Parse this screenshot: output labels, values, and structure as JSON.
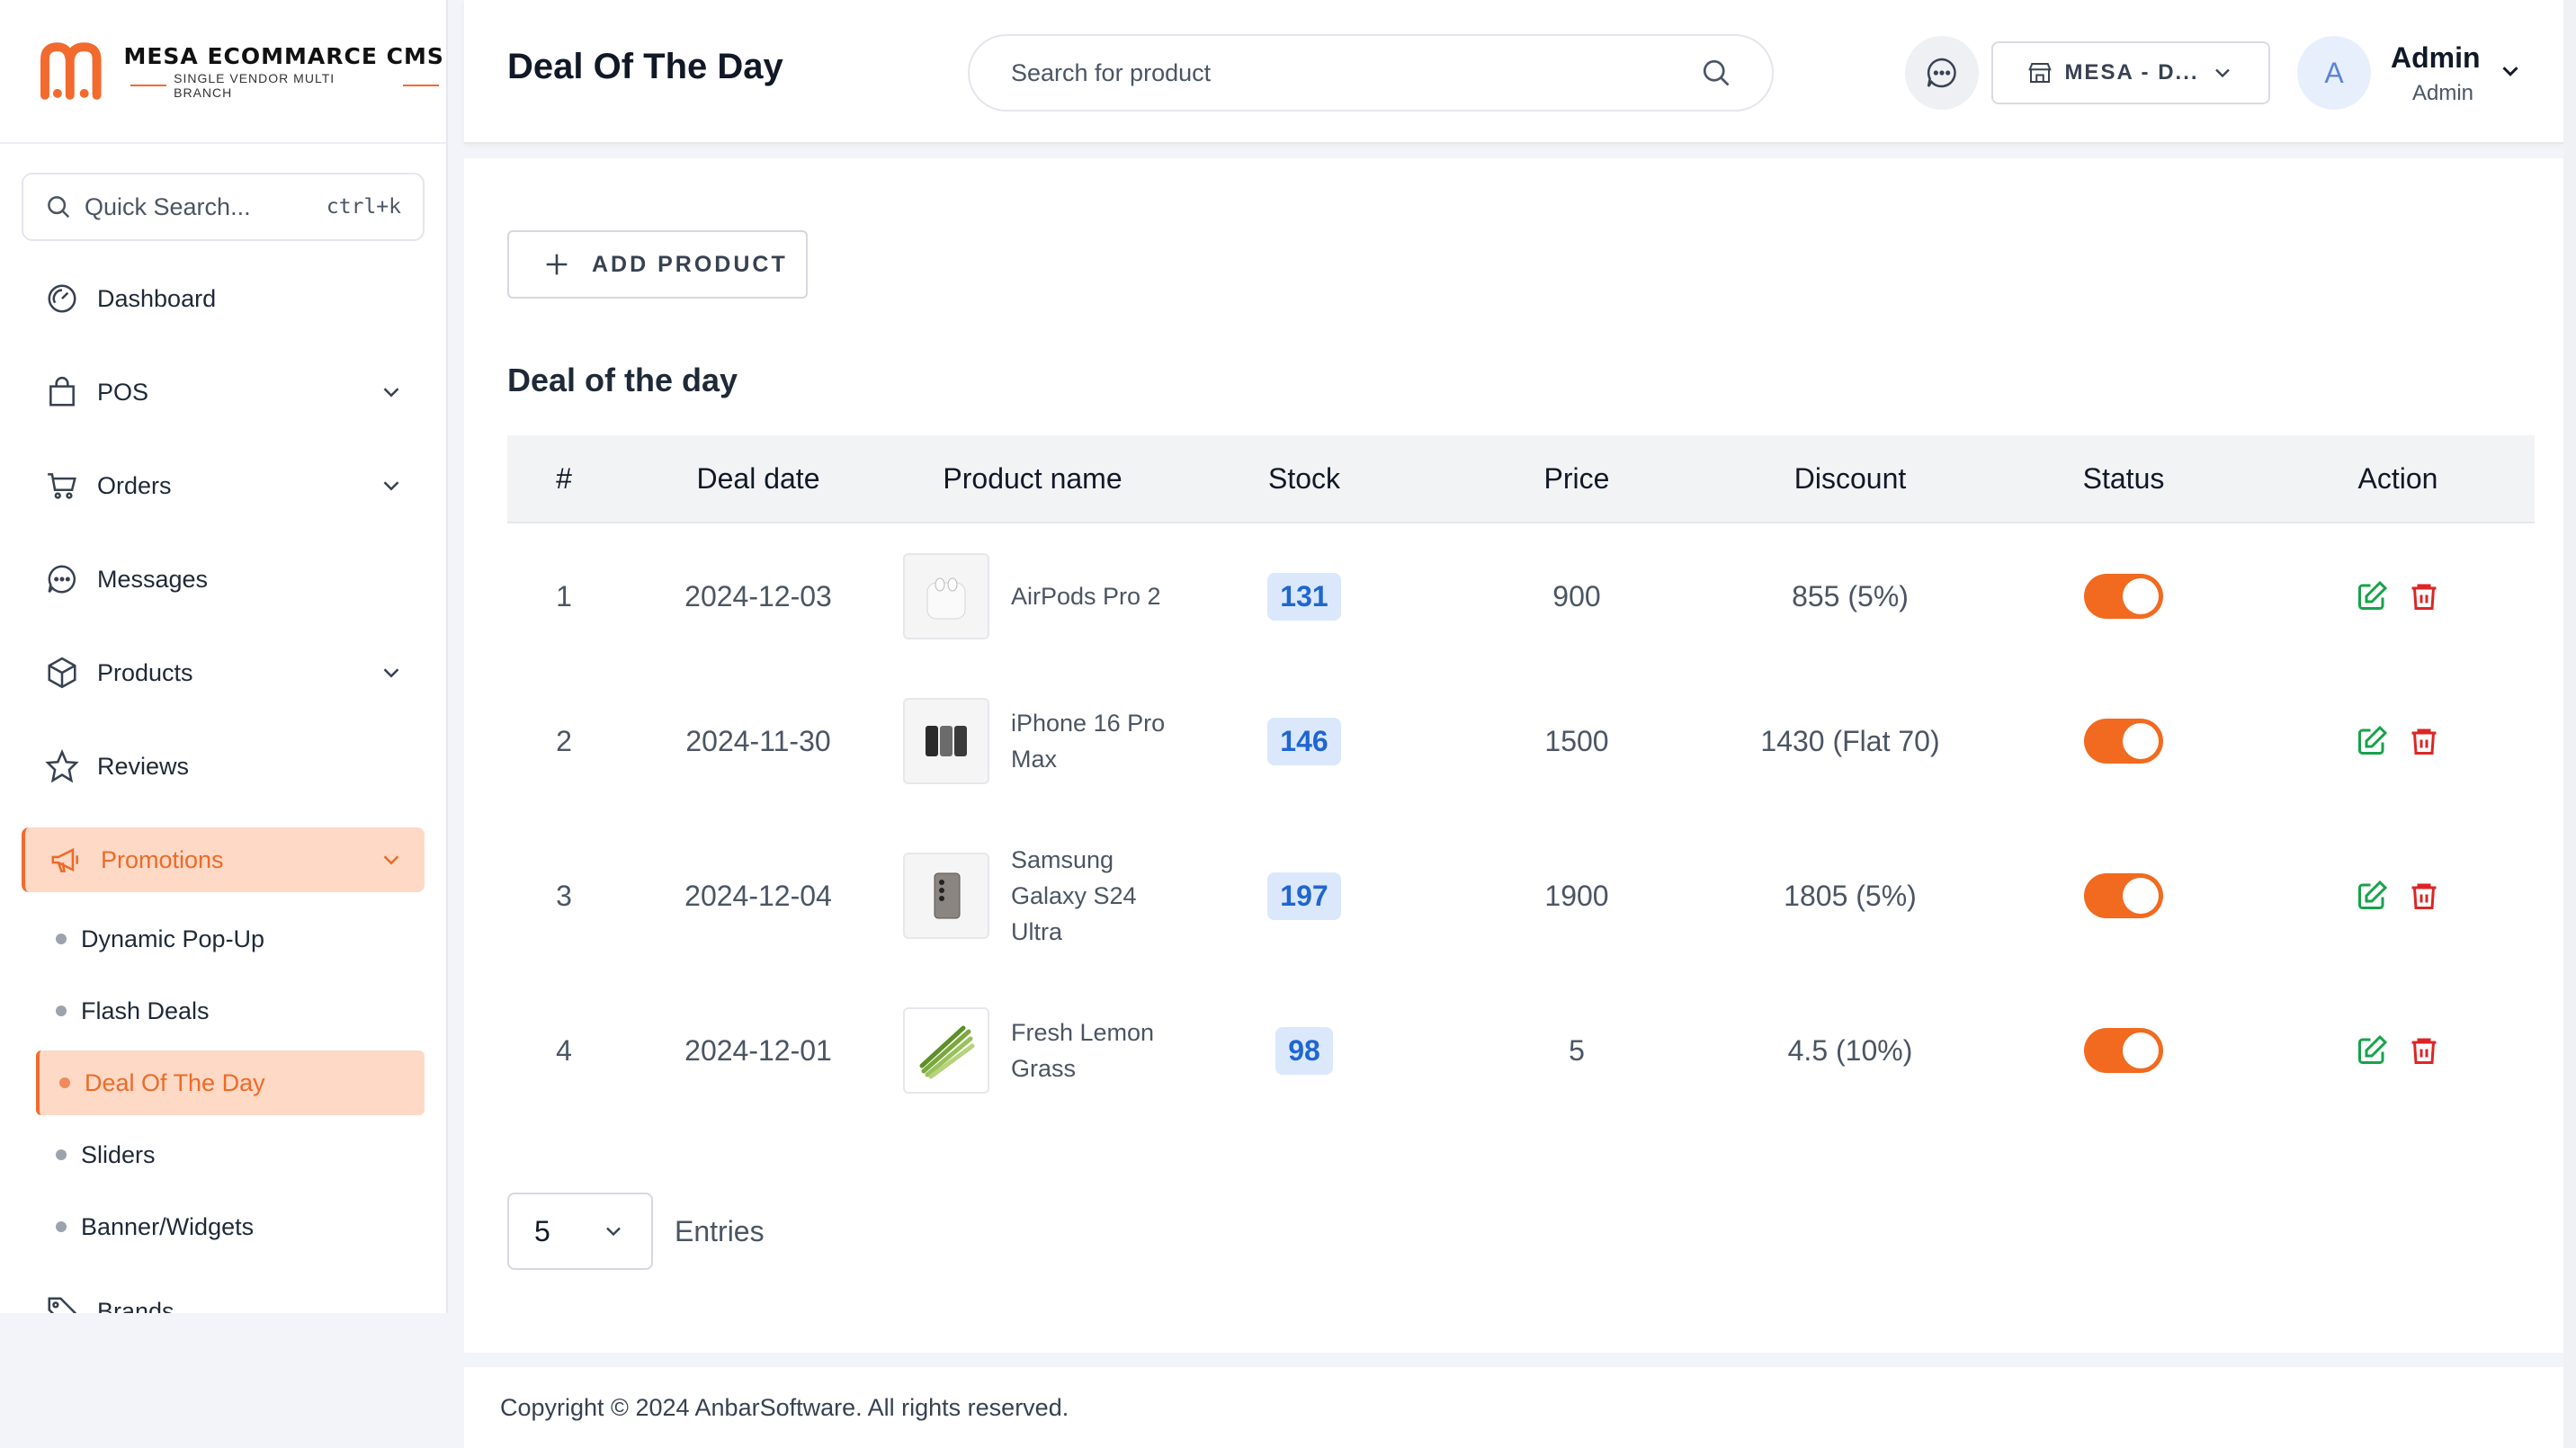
{
  "brand": {
    "name": "MESA ECOMMARCE CMS",
    "tagline": "SINGLE VENDOR MULTI BRANCH",
    "accent": "#f26a2e"
  },
  "quick_search": {
    "placeholder": "Quick Search...",
    "shortcut": "ctrl+k"
  },
  "sidebar": {
    "items": [
      {
        "label": "Dashboard",
        "icon": "dashboard-icon",
        "expandable": false
      },
      {
        "label": "POS",
        "icon": "shopping-bag-icon",
        "expandable": true
      },
      {
        "label": "Orders",
        "icon": "cart-icon",
        "expandable": true
      },
      {
        "label": "Messages",
        "icon": "chat-icon",
        "expandable": false
      },
      {
        "label": "Products",
        "icon": "box-icon",
        "expandable": true
      },
      {
        "label": "Reviews",
        "icon": "star-icon",
        "expandable": false
      },
      {
        "label": "Promotions",
        "icon": "megaphone-icon",
        "expandable": true,
        "active": true
      }
    ],
    "sub_items": [
      {
        "label": "Dynamic Pop-Up"
      },
      {
        "label": "Flash Deals"
      },
      {
        "label": "Deal Of The Day",
        "active": true
      },
      {
        "label": "Sliders"
      },
      {
        "label": "Banner/Widgets"
      }
    ],
    "partial_item": "Brands"
  },
  "header": {
    "title": "Deal Of The Day",
    "search_placeholder": "Search for product",
    "branch_label": "MESA - D...",
    "avatar_letter": "A",
    "user_name": "Admin",
    "user_role": "Admin"
  },
  "main": {
    "add_button": "ADD PRODUCT",
    "section_title": "Deal of the day",
    "columns": [
      "#",
      "Deal date",
      "Product name",
      "Stock",
      "Price",
      "Discount",
      "Status",
      "Action"
    ],
    "rows": [
      {
        "num": "1",
        "date": "2024-12-03",
        "product": "AirPods Pro 2",
        "stock": "131",
        "price": "900",
        "discount": "855 (5%)",
        "status_on": true
      },
      {
        "num": "2",
        "date": "2024-11-30",
        "product": "iPhone 16 Pro Max",
        "stock": "146",
        "price": "1500",
        "discount": "1430 (Flat 70)",
        "status_on": true
      },
      {
        "num": "3",
        "date": "2024-12-04",
        "product": "Samsung Galaxy S24 Ultra",
        "stock": "197",
        "price": "1900",
        "discount": "1805 (5%)",
        "status_on": true
      },
      {
        "num": "4",
        "date": "2024-12-01",
        "product": "Fresh Lemon Grass",
        "stock": "98",
        "price": "5",
        "discount": "4.5 (10%)",
        "status_on": true
      }
    ],
    "entries_value": "5",
    "entries_label": "Entries"
  },
  "footer": {
    "text": "Copyright © 2024 AnbarSoftware. All rights reserved."
  }
}
